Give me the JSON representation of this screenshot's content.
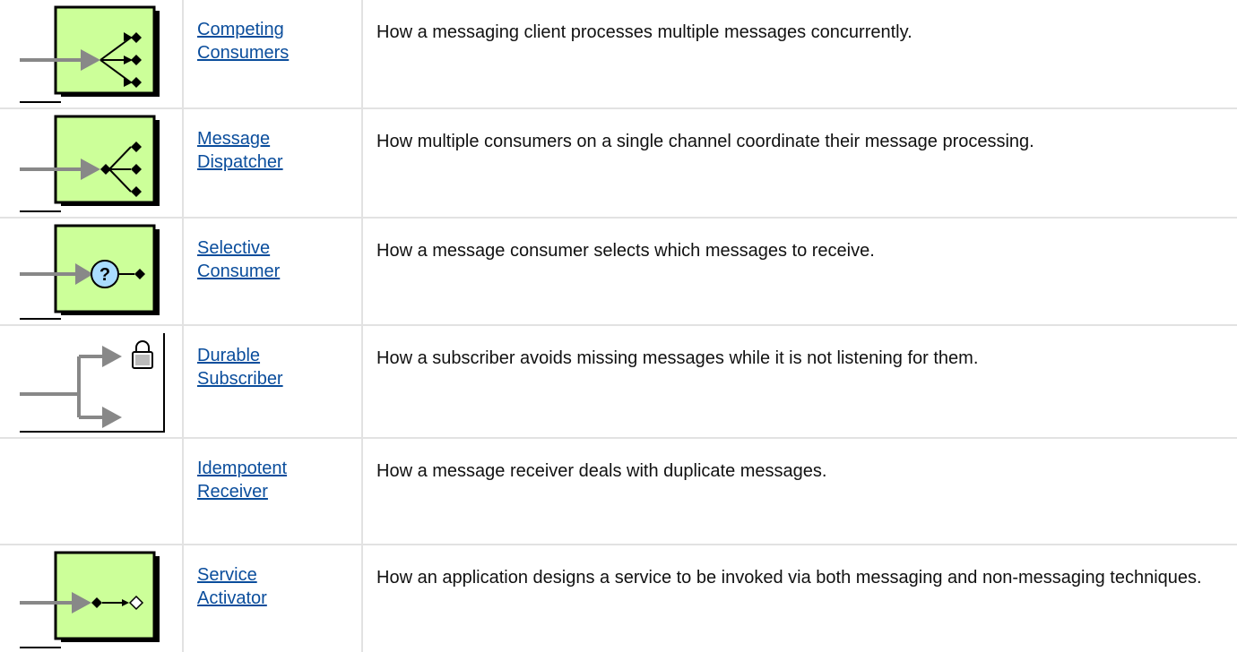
{
  "rows": [
    {
      "icon": "competing-consumers-icon",
      "name_line1": "Competing",
      "name_line2": "Consumers",
      "description": "How a messaging client processes multiple messages concurrently."
    },
    {
      "icon": "message-dispatcher-icon",
      "name_line1": "Message",
      "name_line2": "Dispatcher",
      "description": "How multiple consumers on a single channel coordinate their message processing."
    },
    {
      "icon": "selective-consumer-icon",
      "name_line1": "Selective",
      "name_line2": "Consumer",
      "description": "How a message consumer selects which messages to receive."
    },
    {
      "icon": "durable-subscriber-icon",
      "name_line1": "Durable",
      "name_line2": "Subscriber",
      "description": "How a subscriber avoids missing messages while it is not listening for them."
    },
    {
      "icon": "",
      "name_line1": "Idempotent",
      "name_line2": "Receiver",
      "description": "How a message receiver deals with duplicate messages."
    },
    {
      "icon": "service-activator-icon",
      "name_line1": "Service",
      "name_line2": "Activator",
      "description": "How an application designs a service to be invoked via both messaging and non-messaging techniques."
    }
  ],
  "colors": {
    "icon_fill": "#ccff99",
    "link": "#0a4d9c",
    "grid": "#e2e2e2",
    "arrow": "#888888"
  }
}
